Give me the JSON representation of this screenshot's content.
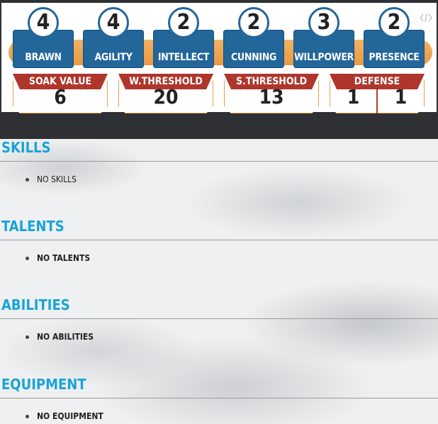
{
  "attributes": [
    {
      "label": "BRAWN",
      "value": "4"
    },
    {
      "label": "AGILITY",
      "value": "4"
    },
    {
      "label": "INTELLECT",
      "value": "2"
    },
    {
      "label": "CUNNING",
      "value": "2"
    },
    {
      "label": "WILLPOWER",
      "value": "3"
    },
    {
      "label": "PRESENCE",
      "value": "2"
    }
  ],
  "derived": {
    "soak": {
      "label": "SOAK VALUE",
      "value": "6"
    },
    "wound": {
      "label": "W.THRESHOLD",
      "value": "20"
    },
    "strain": {
      "label": "S.THRESHOLD",
      "value": "13"
    },
    "defense": {
      "label": "DEFENSE",
      "ranged": "1",
      "melee": "1"
    }
  },
  "sections": {
    "skills": {
      "title": "SKILLS",
      "item": "NO SKILLS"
    },
    "talents": {
      "title": "TALENTS",
      "item": "NO TALENTS"
    },
    "abilities": {
      "title": "ABILITIES",
      "item": "NO ABILITIES"
    },
    "equipment": {
      "title": "EQUIPMENT",
      "item": "NO EQUIPMENT"
    }
  },
  "colors": {
    "accent": "#1aa3d9",
    "attribute": "#22669a",
    "ribbon": "#b43a2e",
    "band": "#e79a44"
  },
  "icons": {
    "embed": "code-icon"
  }
}
